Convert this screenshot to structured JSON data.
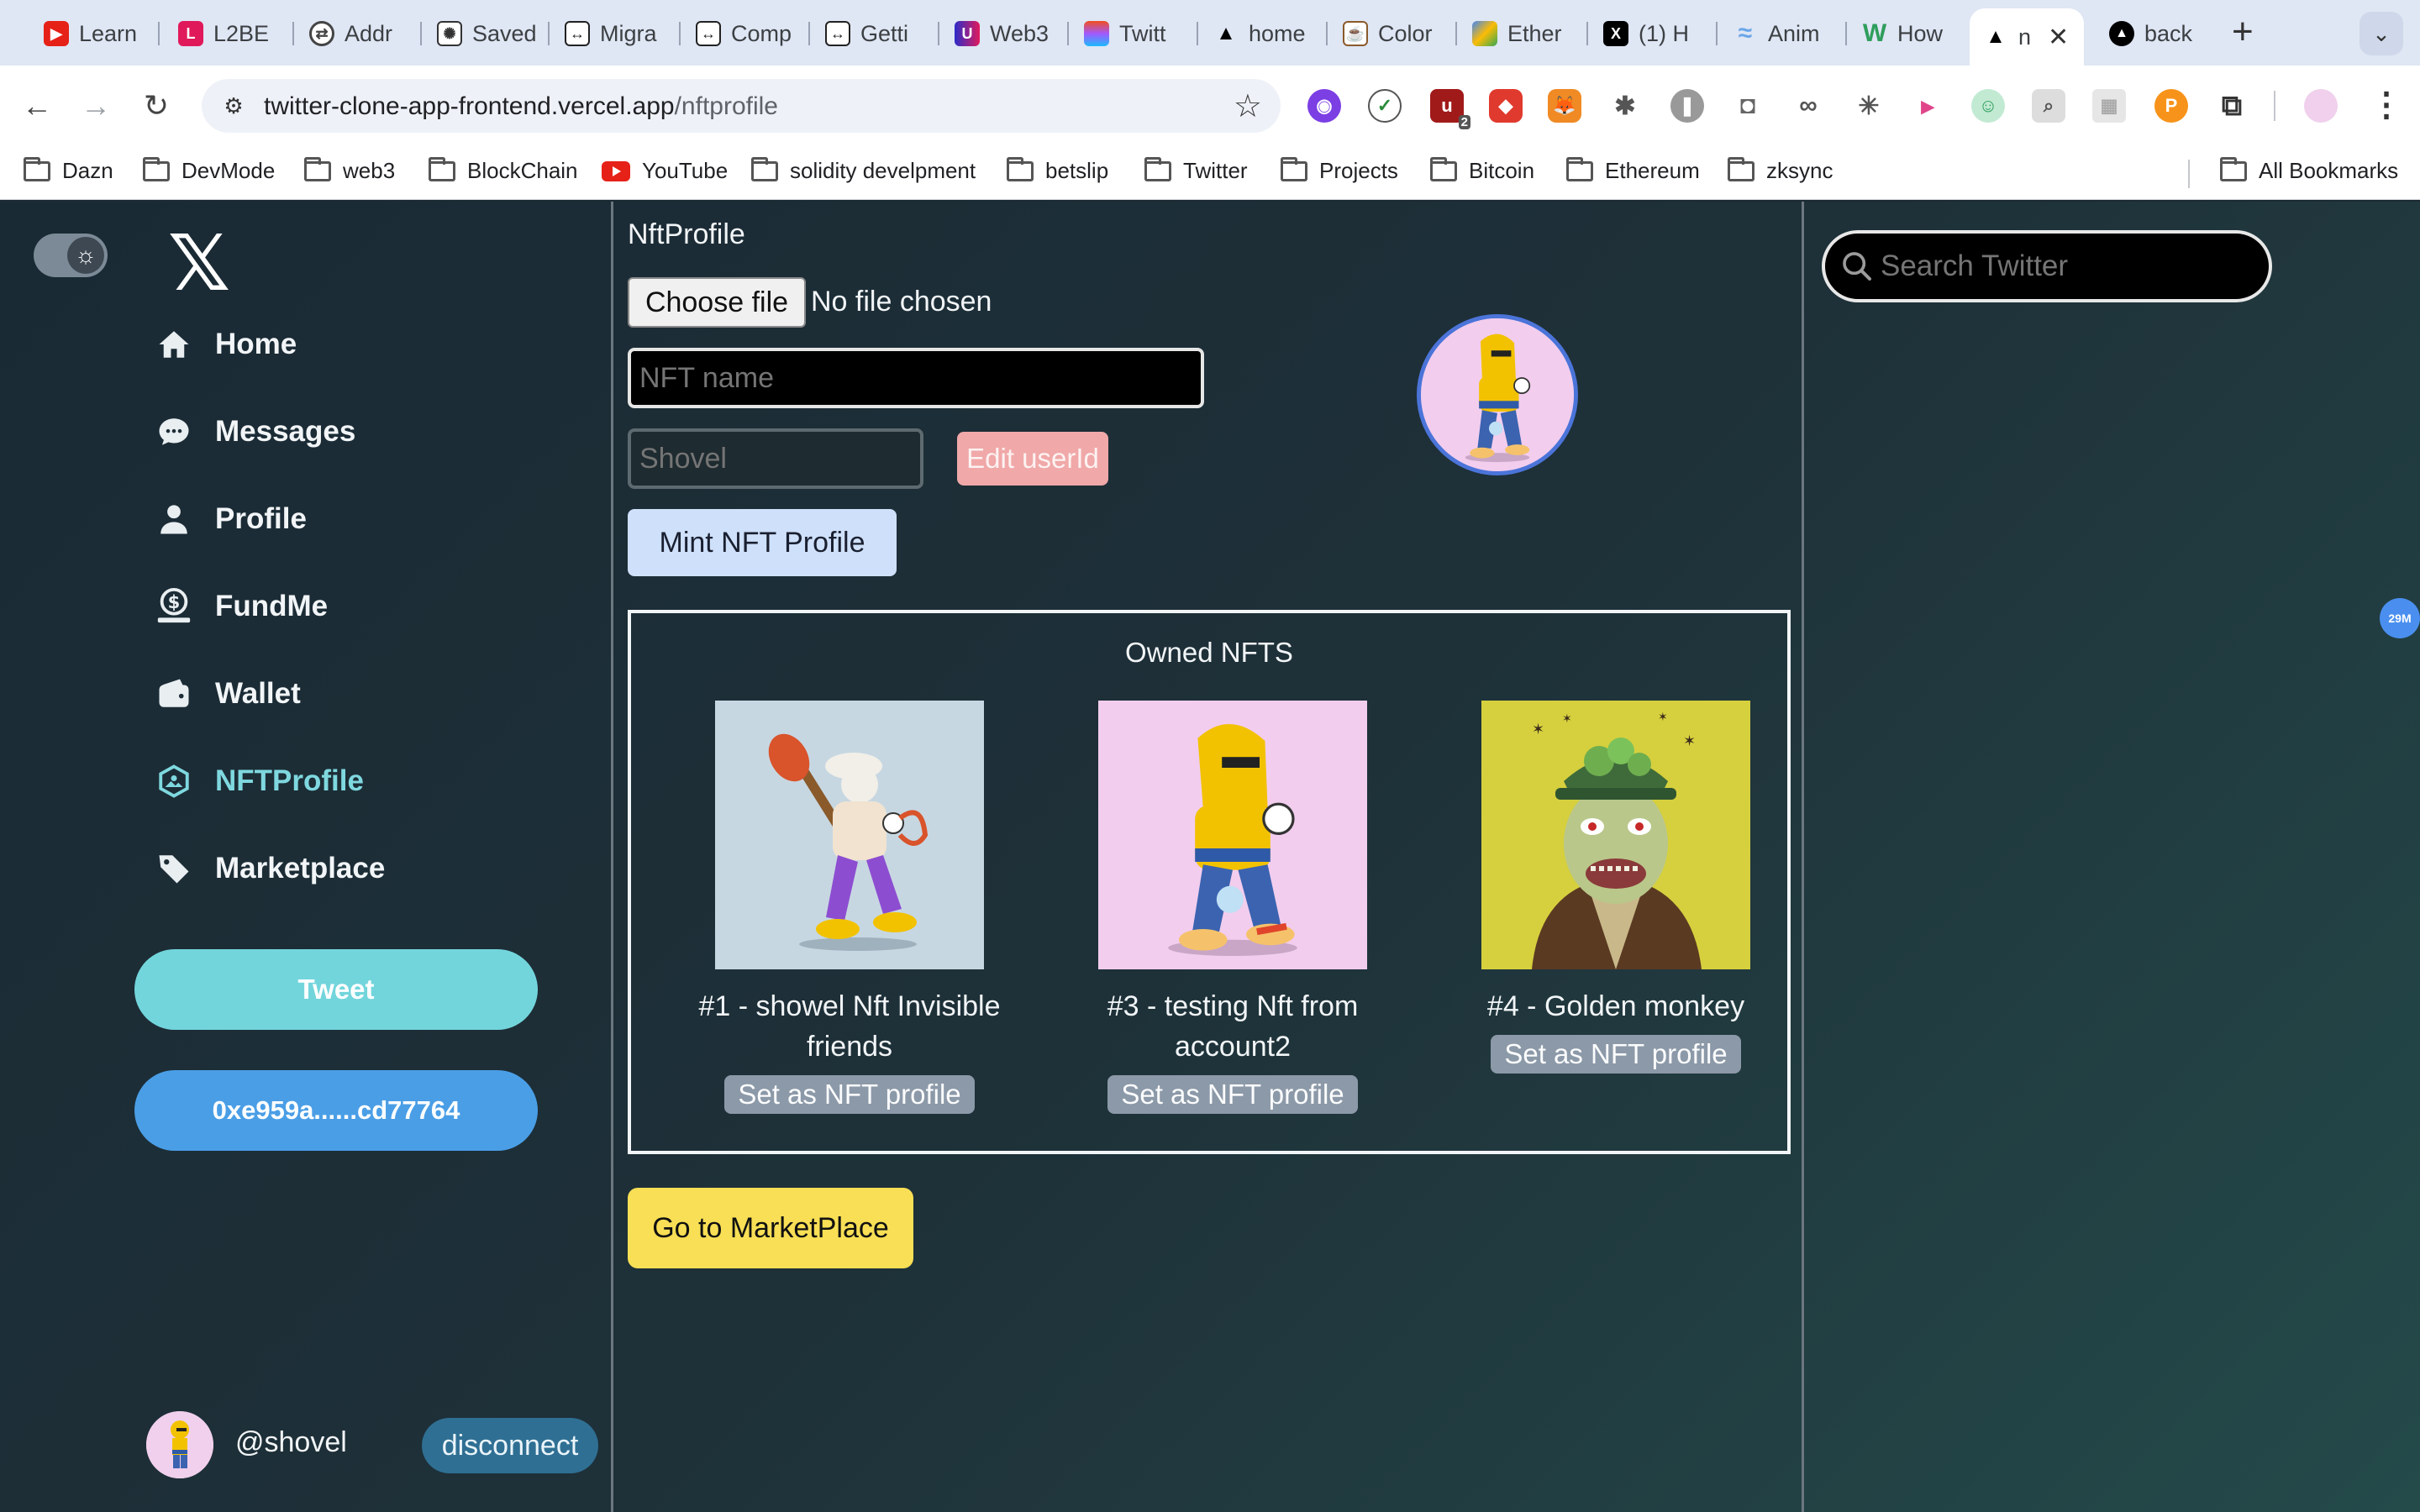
{
  "browser": {
    "tabs": [
      {
        "label": "Learn",
        "icon": "youtube-icon",
        "color": "#e62117"
      },
      {
        "label": "L2BE",
        "icon": "l2beat-icon",
        "color": "#e0195a"
      },
      {
        "label": "Addr",
        "icon": "address-icon",
        "color": "#444444"
      },
      {
        "label": "Saved",
        "icon": "chatgpt-icon",
        "color": "#333333"
      },
      {
        "label": "Migra",
        "icon": "arrows-icon",
        "color": "#222222"
      },
      {
        "label": "Comp",
        "icon": "arrows-icon",
        "color": "#222222"
      },
      {
        "label": "Getti",
        "icon": "arrows-icon",
        "color": "#222222"
      },
      {
        "label": "Web3",
        "icon": "web3-icon",
        "color": "#2c2cc8"
      },
      {
        "label": "Twitt",
        "icon": "figma-icon",
        "color": "#f24e1e"
      },
      {
        "label": "home",
        "icon": "vercel-icon",
        "color": "#000000"
      },
      {
        "label": "Color",
        "icon": "color-icon",
        "color": "#8a5a2b"
      },
      {
        "label": "Ether",
        "icon": "drive-icon",
        "color": "#4285f4"
      },
      {
        "label": "(1) H",
        "icon": "x-icon",
        "color": "#000000"
      },
      {
        "label": "Anim",
        "icon": "framer-icon",
        "color": "#6aa6e8"
      },
      {
        "label": "How",
        "icon": "w-icon",
        "color": "#2e9e5b"
      },
      {
        "label": "n",
        "icon": "vercel-icon",
        "color": "#000000",
        "active": true
      },
      {
        "label": "back",
        "icon": "vercel-icon",
        "color": "#000000"
      }
    ],
    "url_host": "twitter-clone-app-frontend.vercel.app",
    "url_path": "/nftprofile",
    "extension_badge": "2",
    "bookmarks": [
      {
        "label": "Dazn",
        "type": "folder"
      },
      {
        "label": "DevMode",
        "type": "folder"
      },
      {
        "label": "web3",
        "type": "folder"
      },
      {
        "label": "BlockChain",
        "type": "folder"
      },
      {
        "label": "YouTube",
        "type": "youtube"
      },
      {
        "label": "solidity develpment",
        "type": "folder"
      },
      {
        "label": "betslip",
        "type": "folder"
      },
      {
        "label": "Twitter",
        "type": "folder"
      },
      {
        "label": "Projects",
        "type": "folder"
      },
      {
        "label": "Bitcoin",
        "type": "folder"
      },
      {
        "label": "Ethereum",
        "type": "folder"
      },
      {
        "label": "zksync",
        "type": "folder"
      }
    ],
    "all_bookmarks": "All Bookmarks"
  },
  "sidebar": {
    "nav": [
      {
        "label": "Home",
        "icon": "home-icon"
      },
      {
        "label": "Messages",
        "icon": "messages-icon"
      },
      {
        "label": "Profile",
        "icon": "profile-icon"
      },
      {
        "label": "FundMe",
        "icon": "fundme-icon"
      },
      {
        "label": "Wallet",
        "icon": "wallet-icon"
      },
      {
        "label": "NFTProfile",
        "icon": "nft-icon",
        "active": true
      },
      {
        "label": "Marketplace",
        "icon": "tag-icon"
      }
    ],
    "tweet_label": "Tweet",
    "wallet_address": "0xe959a......cd77764",
    "username": "@shovel",
    "disconnect_label": "disconnect"
  },
  "main": {
    "title": "NftProfile",
    "file_button": "Choose file",
    "file_status": "No file chosen",
    "nft_name_placeholder": "NFT name",
    "userid_placeholder": "Shovel",
    "edit_userid_label": "Edit userId",
    "mint_label": "Mint NFT Profile",
    "owned_title": "Owned NFTS",
    "nfts": [
      {
        "name": "#1 - showel Nft Invisible friends",
        "button": "Set as NFT profile",
        "bg": "#c7d7e2"
      },
      {
        "name": "#3 - testing Nft from account2",
        "button": "Set as NFT profile",
        "bg": "#f2cdee"
      },
      {
        "name": "#4 - Golden monkey",
        "button": "Set as NFT profile",
        "bg": "#d6d03e"
      }
    ],
    "marketplace_label": "Go to MarketPlace"
  },
  "search": {
    "placeholder": "Search Twitter"
  },
  "side_badge": "29M",
  "colors": {
    "accent": "#7fd8df",
    "tweet": "#73d5dc",
    "wallet": "#4a9ee6",
    "mint": "#cfe0fa",
    "marketplace": "#f8df55",
    "edit_userid": "#f0a8a8"
  }
}
